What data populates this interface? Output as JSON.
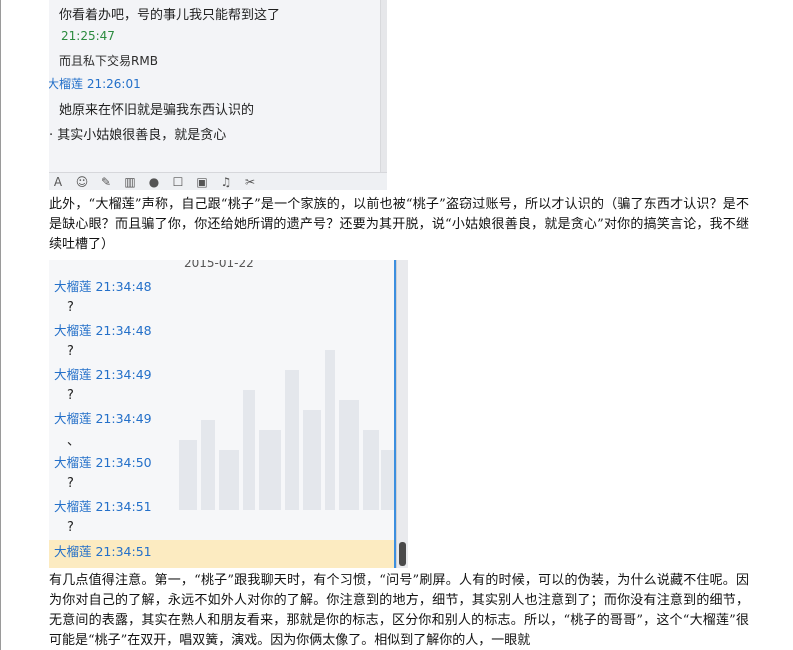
{
  "screenshot1": {
    "lines": [
      {
        "kind": "msg",
        "text": "你看着办吧，号的事儿我只能帮到这了"
      },
      {
        "kind": "time",
        "text": "21:25:47"
      },
      {
        "kind": "meta",
        "text": "而且私下交易RMB"
      },
      {
        "kind": "sender",
        "text": "大榴莲  21:26:01"
      },
      {
        "kind": "msg",
        "text": "她原来在怀旧就是骗我东西认识的"
      },
      {
        "kind": "msg",
        "text": "· 其实小姑娘很善良，就是贪心"
      }
    ],
    "toolbar_icons": [
      "font-icon",
      "emoji-icon",
      "shake-icon",
      "screenshot-icon",
      "voice-icon",
      "edit-icon",
      "image-icon",
      "music-icon",
      "scissors-icon"
    ]
  },
  "paragraph1": "此外，“大榴莲”声称，自己跟“桃子”是一个家族的，以前也被“桃子”盗窃过账号，所以才认识的（骗了东西才认识？是不是缺心眼？而且骗了你，你还给她所谓的遗产号？还要为其开脱，说“小姑娘很善良，就是贪心”对你的搞笑言论，我不继续吐槽了）",
  "screenshot2": {
    "date": "2015-01-22",
    "rows": [
      {
        "head": "大榴莲 21:34:48",
        "msg": "?"
      },
      {
        "head": "大榴莲 21:34:48",
        "msg": "?"
      },
      {
        "head": "大榴莲 21:34:49",
        "msg": "?"
      },
      {
        "head": "大榴莲 21:34:49",
        "msg": "、"
      },
      {
        "head": "大榴莲 21:34:50",
        "msg": "?"
      },
      {
        "head": "大榴莲 21:34:51",
        "msg": "?"
      },
      {
        "head": "大榴莲 21:34:51",
        "msg": ""
      }
    ],
    "highlight_color": "#fcebc1",
    "link_color": "#2470c9"
  },
  "paragraph2": "有几点值得注意。第一，“桃子”跟我聊天时，有个习惯，“问号”刷屏。人有的时候，可以的伪装，为什么说藏不住呢。因为你对自己的了解，永远不如外人对你的了解。你注意到的地方，细节，其实别人也注意到了；而你没有注意到的细节，无意间的表露，其实在熟人和朋友看来，那就是你的标志，区分你和别人的标志。所以，“桃子的哥哥”，这个“大榴莲”很可能是“桃子”在双开，唱双簧，演戏。因为你俩太像了。相似到了解你的人，一眼就"
}
